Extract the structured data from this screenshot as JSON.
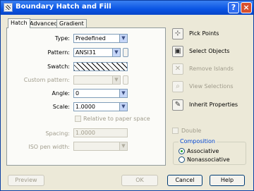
{
  "window": {
    "title": "Boundary Hatch and Fill",
    "help_glyph": "?",
    "close_glyph": "×"
  },
  "tabs": [
    {
      "label": "Hatch",
      "active": true
    },
    {
      "label": "Advanced",
      "active": false
    },
    {
      "label": "Gradient",
      "active": false
    }
  ],
  "hatch": {
    "type_label": "Type:",
    "type_value": "Predefined",
    "pattern_label": "Pattern:",
    "pattern_value": "ANSI31",
    "swatch_label": "Swatch:",
    "custom_pattern_label": "Custom pattern:",
    "custom_pattern_value": "",
    "angle_label": "Angle:",
    "angle_value": "0",
    "scale_label": "Scale:",
    "scale_value": "1.0000",
    "relative_label": "Relative to paper space",
    "spacing_label": "Spacing:",
    "spacing_value": "1.0000",
    "iso_label": "ISO pen width:",
    "iso_value": ""
  },
  "side": {
    "pick_points": "Pick Points",
    "select_objects": "Select Objects",
    "remove_islands": "Remove Islands",
    "view_selections": "View Selections",
    "inherit_properties": "Inherit Properties",
    "double_label": "Double",
    "composition_title": "Composition",
    "associative": "Associative",
    "nonassociative": "Nonassociative",
    "associative_selected": true
  },
  "footer": {
    "preview": "Preview",
    "ok": "OK",
    "cancel": "Cancel",
    "help": "Help"
  },
  "icons": {
    "dropdown": "▼",
    "pick_points": "⊹",
    "select_objects": "▣",
    "remove_islands": "✕",
    "view_selections": "⌕",
    "inherit_properties": "✎"
  }
}
